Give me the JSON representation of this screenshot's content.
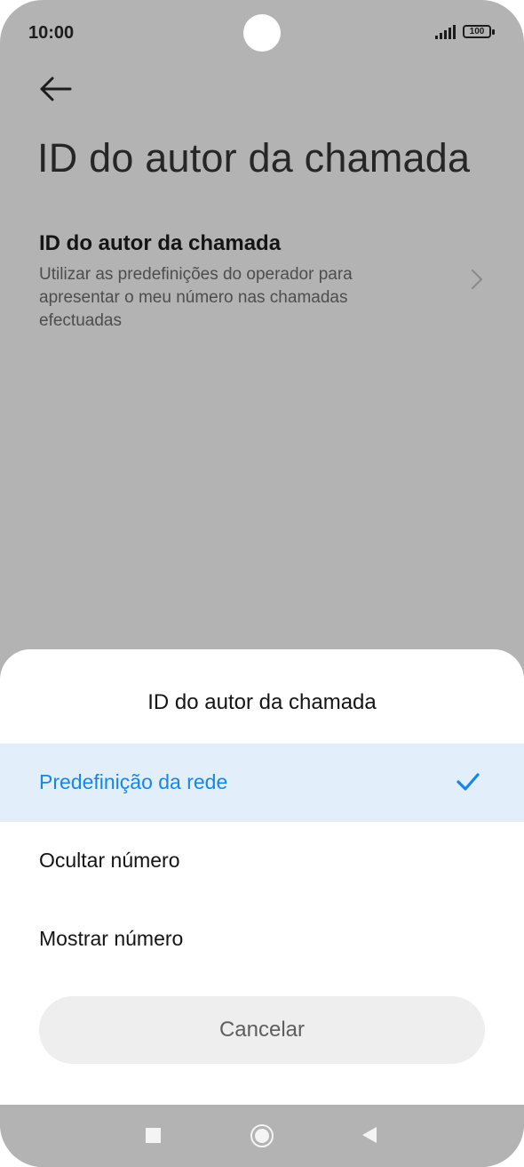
{
  "status_bar": {
    "time": "10:00",
    "battery": "100"
  },
  "page": {
    "title": "ID do autor da chamada",
    "setting": {
      "title": "ID do autor da chamada",
      "summary": "Utilizar as predefinições do operador para apresentar o meu número nas chamadas efectuadas"
    }
  },
  "sheet": {
    "title": "ID do autor da chamada",
    "options": [
      {
        "label": "Predefinição da rede",
        "selected": true
      },
      {
        "label": "Ocultar número",
        "selected": false
      },
      {
        "label": "Mostrar número",
        "selected": false
      }
    ],
    "cancel_label": "Cancelar"
  },
  "icons": {
    "back": "arrow-left-icon",
    "chevron": "chevron-right-icon",
    "check": "check-icon",
    "nav": [
      "recents-square-icon",
      "home-circle-icon",
      "back-triangle-icon"
    ]
  },
  "colors": {
    "accent": "#1686e8",
    "selected_bg": "#e2effb",
    "scrim": "#b3b3b3"
  }
}
